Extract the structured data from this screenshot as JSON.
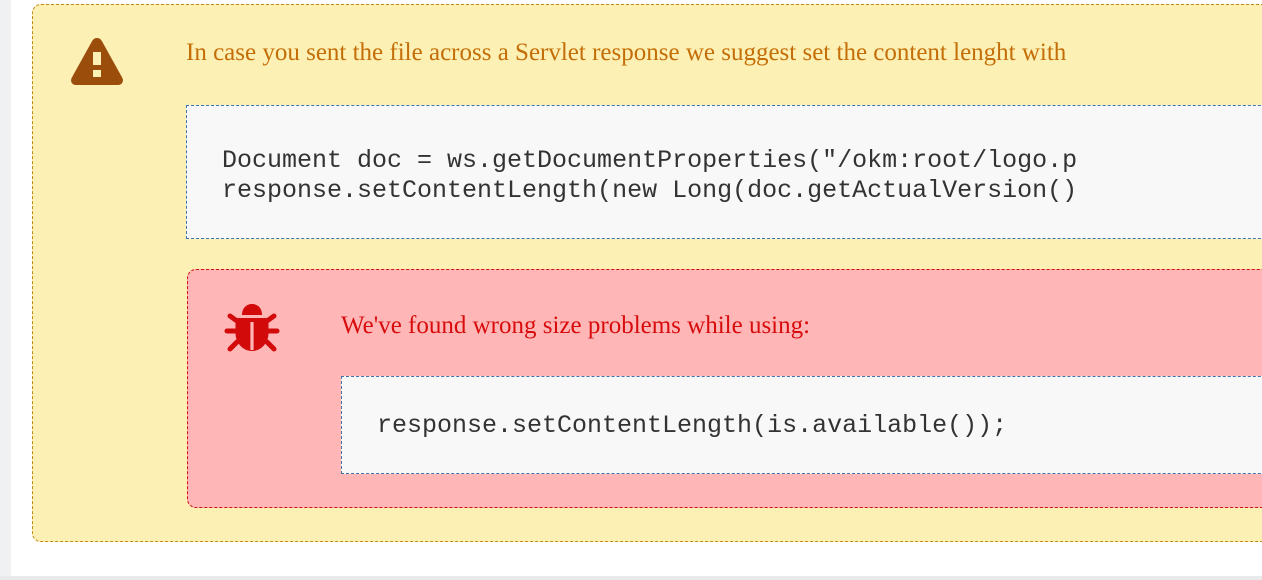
{
  "warning": {
    "icon": "warning-triangle-icon",
    "color": "#c46e08",
    "background": "#fdf0b4",
    "text": "In case you sent the file across a Servlet response we suggest set the content lenght with",
    "code_lines": [
      "Document doc = ws.getDocumentProperties(\"/okm:root/logo.p",
      "response.setContentLength(new Long(doc.getActualVersion()"
    ]
  },
  "bug": {
    "icon": "bug-icon",
    "color": "#d80c0c",
    "background": "#ffb6b6",
    "text": "We've found wrong size problems while using:",
    "code_lines": [
      "response.setContentLength(is.available());"
    ]
  }
}
